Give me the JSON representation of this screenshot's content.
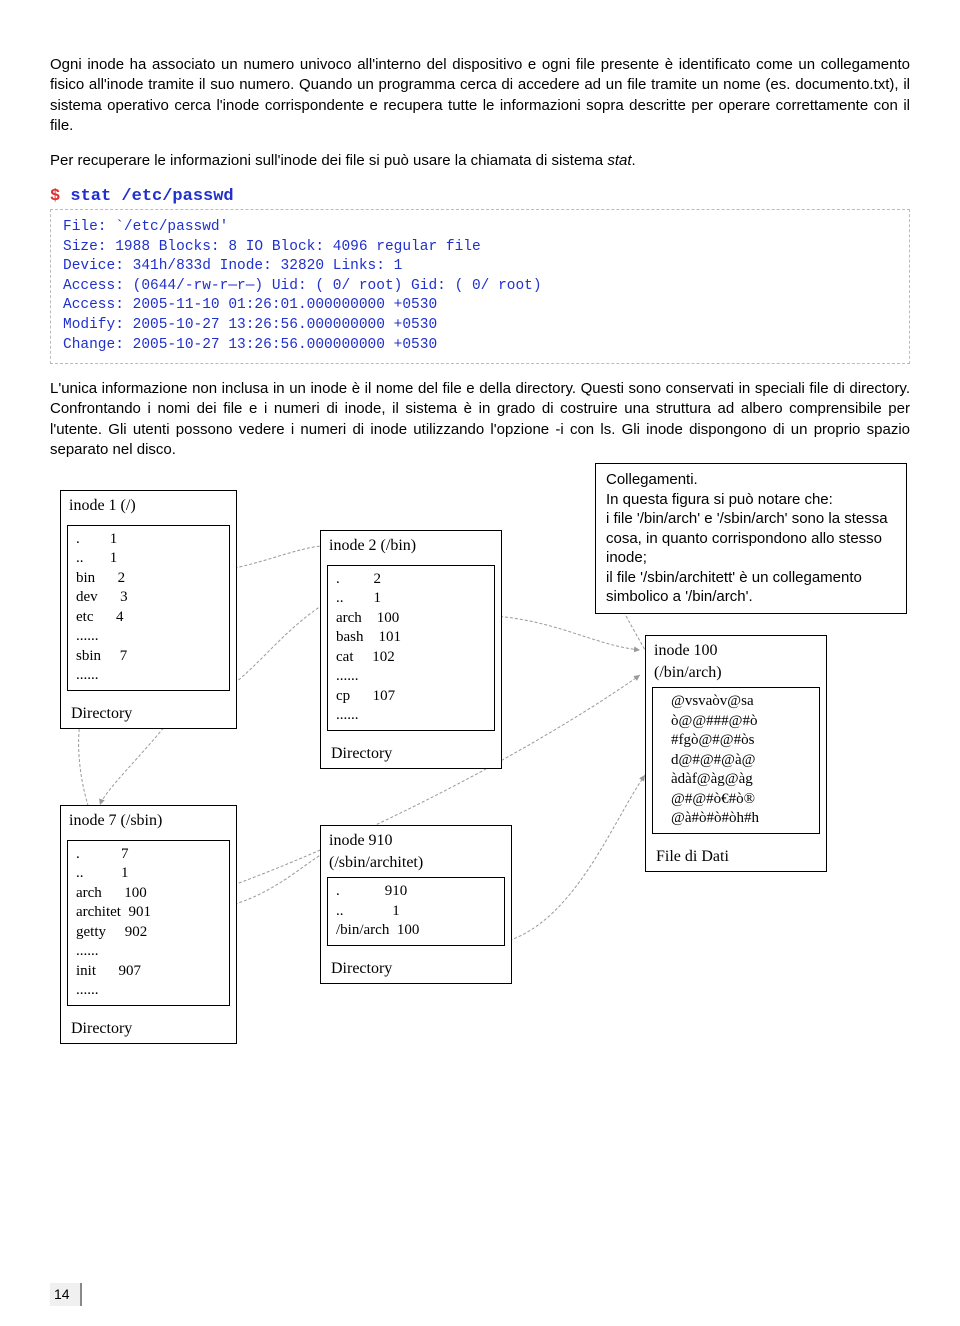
{
  "para1": "Ogni inode ha associato un numero univoco all'interno del dispositivo e ogni file presente è identificato come un collegamento fisico all'inode tramite il suo numero. Quando un programma cerca di accedere ad un file tramite un nome (es. documento.txt), il sistema operativo cerca l'inode corrispondente e recupera tutte le informazioni sopra descritte per operare correttamente con il file.",
  "para2_a": "Per recuperare le informazioni sull'inode dei file si può usare la chiamata di sistema ",
  "para2_b": "stat",
  "para2_c": ".",
  "cmd_prompt": "$ ",
  "cmd_text": "stat /etc/passwd",
  "code": {
    "l1": "File: `/etc/passwd'",
    "l2": "Size: 1988 Blocks: 8 IO Block: 4096 regular file",
    "l3": "Device: 341h/833d Inode: 32820 Links: 1",
    "l4": "Access: (0644/-rw-r—r—) Uid: ( 0/ root) Gid: ( 0/ root)",
    "l5": "Access: 2005-11-10 01:26:01.000000000 +0530",
    "l6": "Modify: 2005-10-27 13:26:56.000000000 +0530",
    "l7": "Change: 2005-10-27 13:26:56.000000000 +0530"
  },
  "para3": "L'unica informazione non inclusa in un inode è il nome del file e della directory. Questi sono conservati in speciali file di directory. Confrontando i nomi dei file e i numeri di inode, il sistema è in grado di costruire una struttura ad albero comprensibile per l'utente. Gli utenti possono vedere i numeri di inode utilizzando l'opzione -i con ls. Gli inode dispongono di un proprio spazio separato nel disco.",
  "note": {
    "l1": "Collegamenti.",
    "l2": "In questa figura si può notare che:",
    "l3": "i file '/bin/arch' e '/sbin/arch' sono la stessa cosa, in quanto corrispondono allo stesso inode;",
    "l4": "il file '/sbin/architett' è un collegamento simbolico a '/bin/arch'."
  },
  "box1": {
    "title": "inode 1          (/)",
    "rows": ".        1\n..       1\nbin      2\ndev      3\netc      4\n......\nsbin     7\n......",
    "foot": "Directory"
  },
  "box2": {
    "title": "inode 2      (/bin)",
    "rows": ".         2\n..        1\narch    100\nbash    101\ncat     102\n......\ncp      107\n......",
    "foot": "Directory"
  },
  "box7": {
    "title": "inode 7     (/sbin)",
    "rows": ".           7\n..          1\narch      100\narchitet  901\ngetty     902\n......\ninit      907\n......",
    "foot": "Directory"
  },
  "box910": {
    "title_a": "inode 910",
    "title_b": "(/sbin/architet)",
    "rows": ".            910\n..             1\n/bin/arch  100",
    "foot": "Directory"
  },
  "box100": {
    "title_a": "inode 100",
    "title_b": "(/bin/arch)",
    "rows": "@vsvaòv@sa\nò@@###@#ò\n#fgò@#@#òs\nd@#@#@à@\nàdàf@àg@àg\n@#@#ò€#ò®\n@à#ò#ò#òh#h",
    "foot": "File di Dati"
  },
  "page_number": "14"
}
